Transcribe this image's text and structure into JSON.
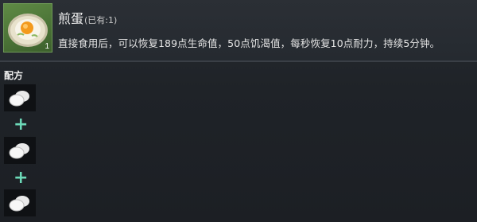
{
  "item": {
    "icon": "fried-egg-plate-icon",
    "count": "1",
    "name": "煎蛋",
    "owned": "(已有:1)",
    "description": "直接食用后，可以恢复189点生命值，50点饥渴值，每秒恢复10点耐力，持续5分钟。"
  },
  "recipe": {
    "label": "配方",
    "ingredients": [
      {
        "icon": "egg-icon"
      },
      {
        "icon": "egg-icon"
      },
      {
        "icon": "egg-icon"
      }
    ],
    "separator": "+"
  },
  "colors": {
    "plus": "#6cd9b8",
    "item_slot_bg": "#5f8a45"
  }
}
